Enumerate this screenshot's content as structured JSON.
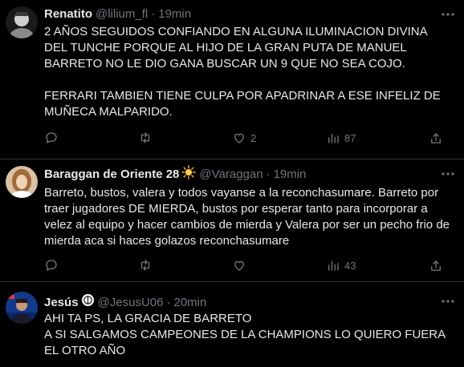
{
  "tweets": [
    {
      "name": "Renatito",
      "handle": "@lilium_fl",
      "time": "19min",
      "text": "2 AÑOS SEGUIDOS CONFIANDO EN ALGUNA ILUMINACION DIVINA DEL TUNCHE PORQUE AL HIJO DE LA GRAN PUTA DE MANUEL BARRETO NO LE DIO GANA BUSCAR UN 9 QUE NO SEA COJO.\n\nFERRARI TAMBIEN TIENE CULPA POR APADRINAR A ESE INFELIZ DE MUÑECA MALPARIDO.",
      "replies": "",
      "retweets": "",
      "likes": "2",
      "views": "87"
    },
    {
      "name": "Baraggan de Oriente 28",
      "handle": "@Varaggan",
      "time": "19min",
      "text": "Barreto, bustos, valera y todos vayanse a la reconchasumare. Barreto por traer jugadores DE MIERDA, bustos por esperar tanto para incorporar a velez al equipo y hacer cambios de mierda y Valera por ser un pecho frio de mierda aca si haces golazos reconchasumare",
      "replies": "",
      "retweets": "",
      "likes": "",
      "views": "43"
    },
    {
      "name": "Jesús",
      "handle": "@JesusU06",
      "time": "20min",
      "text": "AHI TA PS, LA GRACIA DE BARRETO\nA SI SALGAMOS CAMPEONES DE LA CHAMPIONS LO QUIERO FUERA EL OTRO AÑO"
    }
  ],
  "colors": {
    "bg": "#000000",
    "text": "#e7e9ea",
    "muted": "#71767b",
    "divider": "#2f3336"
  }
}
